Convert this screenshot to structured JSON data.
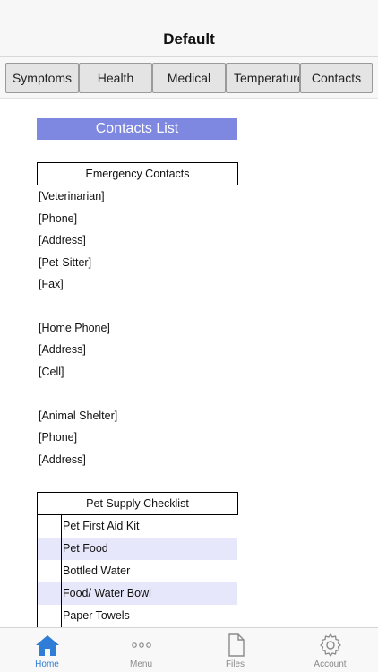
{
  "navbar": {
    "title": "Default"
  },
  "segments": [
    {
      "label": "Symptoms"
    },
    {
      "label": "Health"
    },
    {
      "label": "Medical"
    },
    {
      "label": "Temperature"
    },
    {
      "label": "Contacts"
    }
  ],
  "contacts": {
    "title": "Contacts List",
    "emergency_header": "Emergency Contacts",
    "rows": [
      "[Veterinarian]",
      "[Phone]",
      "[Address]",
      "[Pet-Sitter]",
      "[Fax]",
      "[Home Phone]",
      "[Address]",
      "[Cell]",
      "[Animal Shelter]",
      "[Phone]",
      "[Address]"
    ],
    "checklist_header": "Pet Supply Checklist",
    "checklist": [
      "Pet First Aid Kit",
      "Pet Food",
      "Bottled Water",
      "Food/ Water Bowl",
      "Paper Towels"
    ]
  },
  "tabs": [
    {
      "label": "Home",
      "icon": "home-icon",
      "active": true
    },
    {
      "label": "Menu",
      "icon": "more-dots-icon",
      "active": false
    },
    {
      "label": "Files",
      "icon": "file-icon",
      "active": false
    },
    {
      "label": "Account",
      "icon": "gear-icon",
      "active": false
    }
  ],
  "colors": {
    "accent": "#2f7dd6",
    "header_fill": "#7f88e0",
    "alt_row": "#e6e7fb"
  }
}
